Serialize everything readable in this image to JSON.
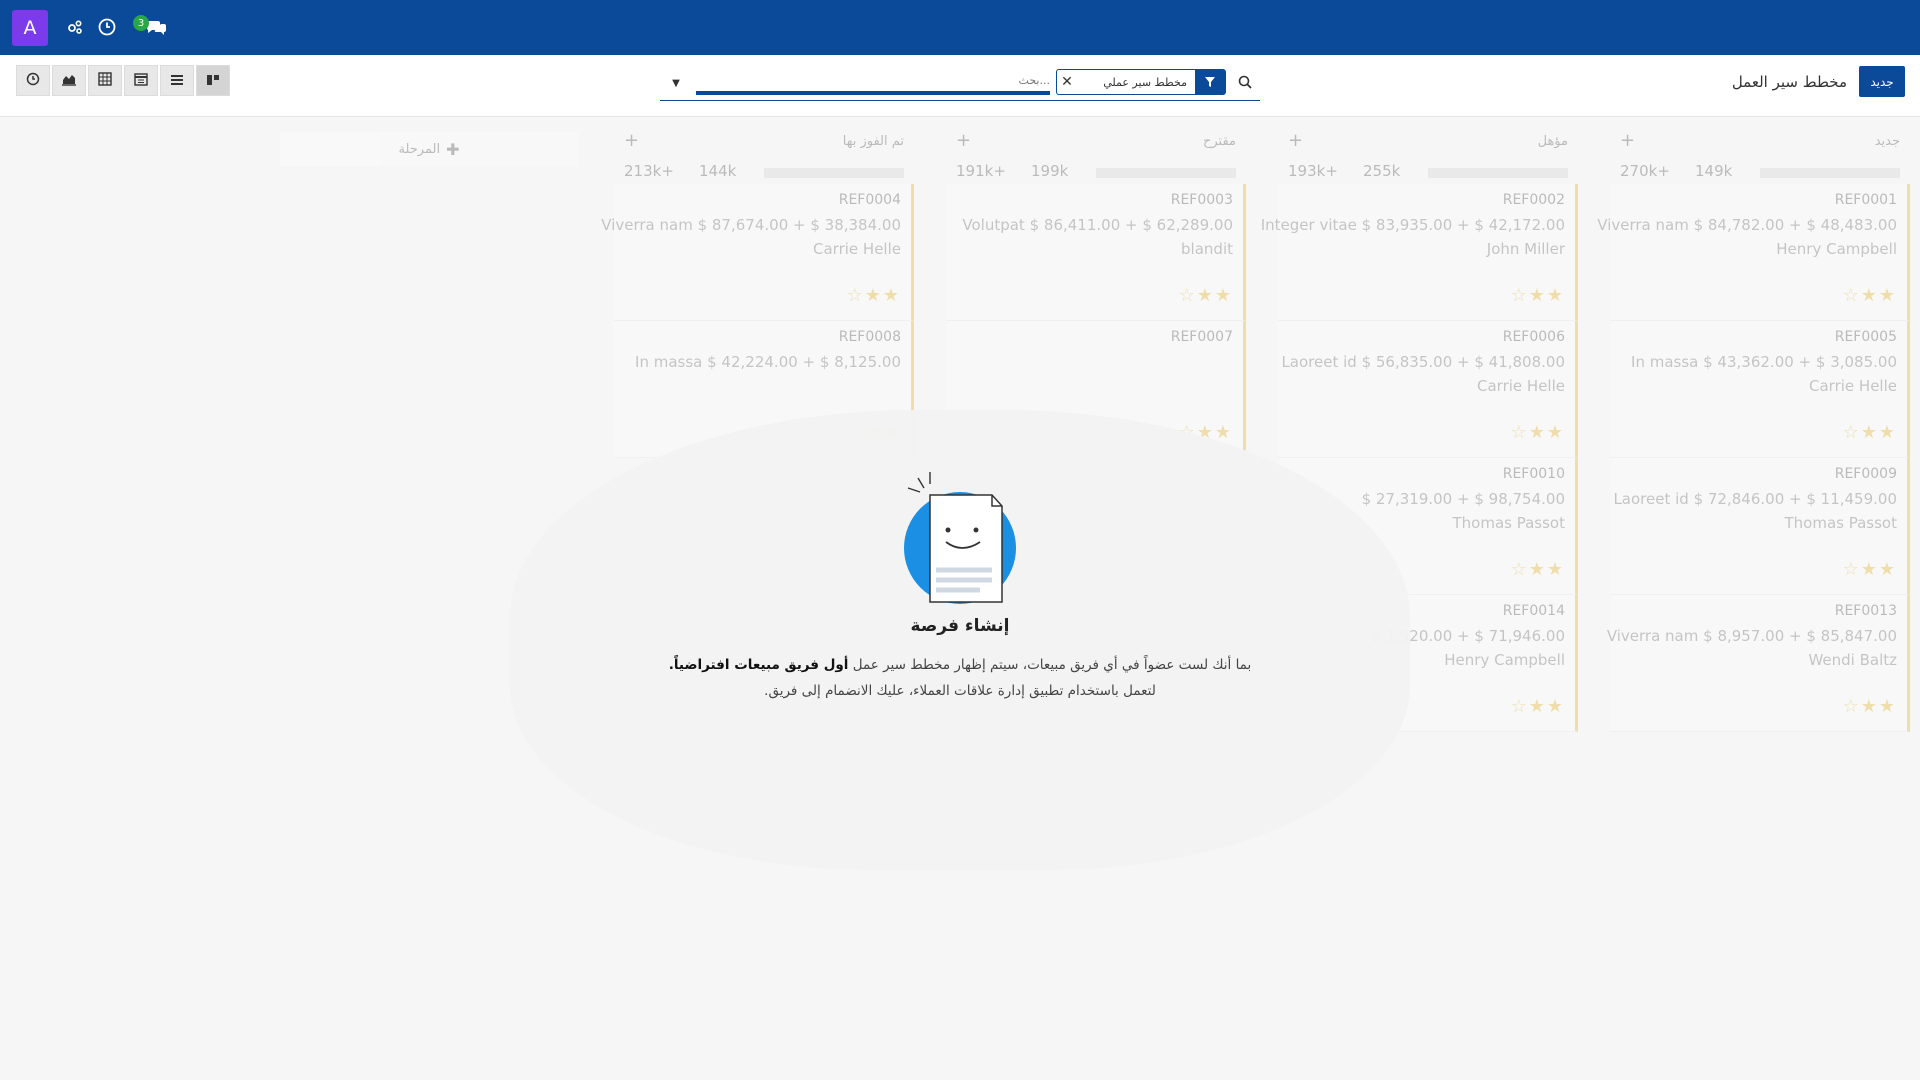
{
  "navbar": {
    "avatar_letter": "A",
    "messages_count": "3",
    "icons": [
      "activity-icon",
      "clock-icon",
      "chat-icon"
    ]
  },
  "control": {
    "new_label": "جديد",
    "breadcrumb": "مخطط سير العمل",
    "facet_label": "مخطط سير عملي",
    "search_placeholder": "بحث...",
    "views": [
      "activity-view",
      "graph-view",
      "pivot-view",
      "calendar-view",
      "list-view",
      "kanban-view"
    ]
  },
  "kanban": {
    "add_stage_label": "المرحلة",
    "columns": [
      {
        "title": "جديد",
        "total": "270k+",
        "sub": "149k",
        "cards": [
          {
            "ref": "REF0001",
            "line": "Viverra nam $ 84,782.00 + $ 48,483.00",
            "person": "Henry Campbell"
          },
          {
            "ref": "REF0005",
            "line": "In massa $ 43,362.00 + $ 3,085.00",
            "person": "Carrie Helle"
          },
          {
            "ref": "REF0009",
            "line": "Laoreet id $ 72,846.00 + $ 11,459.00",
            "person": "Thomas Passot"
          },
          {
            "ref": "REF0013",
            "line": "Viverra nam $ 8,957.00 + $ 85,847.00",
            "person": "Wendi Baltz"
          }
        ]
      },
      {
        "title": "مؤهل",
        "total": "193k+",
        "sub": "255k",
        "cards": [
          {
            "ref": "REF0002",
            "line": "Integer vitae $ 83,935.00 + $ 42,172.00",
            "person": "John Miller"
          },
          {
            "ref": "REF0006",
            "line": "Laoreet id $ 56,835.00 + $ 41,808.00",
            "person": "Carrie Helle"
          },
          {
            "ref": "REF0010",
            "line": "$ 27,319.00 + $ 98,754.00",
            "person": "Thomas Passot"
          },
          {
            "ref": "REF0014",
            "line": "$ 1,920.00 + $ 71,946.00",
            "person": "Henry Campbell"
          }
        ]
      },
      {
        "title": "مقترح",
        "total": "191k+",
        "sub": "199k",
        "cards": [
          {
            "ref": "REF0003",
            "line": "Volutpat $ 86,411.00 + $ 62,289.00",
            "person": "blandit"
          },
          {
            "ref": "REF0007",
            "line": "",
            "person": ""
          }
        ]
      },
      {
        "title": "تم الفوز بها",
        "total": "213k+",
        "sub": "144k",
        "cards": [
          {
            "ref": "REF0004",
            "line": "Viverra nam $ 87,674.00 + $ 38,384.00",
            "person": "Carrie Helle"
          },
          {
            "ref": "REF0008",
            "line": "In massa $ 42,224.00 + $ 8,125.00",
            "person": ""
          }
        ]
      }
    ]
  },
  "help": {
    "title": "إنشاء فرصة",
    "text_part1": "بما أنك لست عضواً في أي فريق مبيعات، سيتم إظهار مخطط سير عمل ",
    "text_bold": "أول فريق مبيعات افتراضياً.",
    "text_part2": " لتعمل باستخدام تطبيق إدارة علاقات العملاء، عليك الانضمام إلى فريق."
  },
  "colors": {
    "brand": "#0b4a98",
    "avatar": "#7c3aed",
    "badge": "#28a745",
    "illustration": "#1a8fe3",
    "card_accent": "#e0a800"
  }
}
